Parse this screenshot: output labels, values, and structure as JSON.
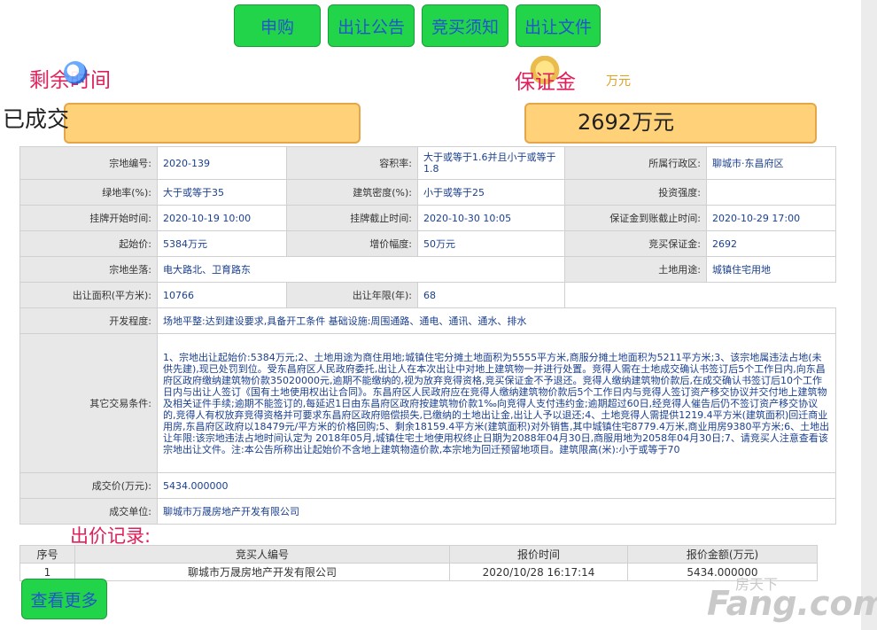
{
  "tabs": [
    "申购",
    "出让公告",
    "竞买须知",
    "出让文件"
  ],
  "header": {
    "remaining_label": "剩余时间",
    "deposit_label": "保证金",
    "deposit_unit": "万元",
    "status": "已成交",
    "deposit_value": "2692万元"
  },
  "info": {
    "code_label": "宗地编号:",
    "code": "2020-139",
    "far_label": "容积率:",
    "far": "大于或等于1.6并且小于或等于1.8",
    "district_label": "所属行政区:",
    "district": "聊城市·东昌府区",
    "green_label": "绿地率(%):",
    "green": "大于或等于35",
    "density_label": "建筑密度(%):",
    "density": "小于或等于25",
    "intensity_label": "投资强度:",
    "intensity": "",
    "start_label": "挂牌开始时间:",
    "start": "2020-10-19 10:00",
    "end_label": "挂牌截止时间:",
    "end": "2020-10-30 10:05",
    "deposit_deadline_label": "保证金到账截止时间:",
    "deposit_deadline": "2020-10-29 17:00",
    "start_price_label": "起始价:",
    "start_price": "5384万元",
    "increment_label": "增价幅度:",
    "increment": "50万元",
    "bid_deposit_label": "竞买保证金:",
    "bid_deposit": "2692",
    "location_label": "宗地坐落:",
    "location": "电大路北、卫育路东",
    "use_label": "土地用途:",
    "use": "城镇住宅用地",
    "area_label": "出让面积(平方米):",
    "area": "10766",
    "years_label": "出让年限(年):",
    "years": "68",
    "dev_label": "开发程度:",
    "dev": "场地平整:达到建设要求,具备开工条件 基础设施:周围通路、通电、通讯、通水、排水",
    "other_label": "其它交易条件:",
    "other": "1、宗地出让起始价:5384万元;2、土地用途为商住用地;城镇住宅分摊土地面积为5555平方米,商服分摊土地面积为5211平方米;3、该宗地属违法占地(未供先建),现已处罚到位。受东昌府区人民政府委托,出让人在本次出让中对地上建筑物一并进行处置。竞得人需在土地成交确认书签订后5个工作日内,向东昌府区政府缴纳建筑物价款35020000元,逾期不能缴纳的,视为放弃竞得资格,竞买保证金不予退还。竞得人缴纳建筑物价款后,在成交确认书签订后10个工作日内与出让人签订《国有土地使用权出让合同》。东昌府区人民政府应在竞得人缴纳建筑物价款后5个工作日内与竞得人签订资产移交协议并交付地上建筑物及相关证件手续;逾期不能签订的,每延迟1日由东昌府区政府按建筑物价款1‰向竞得人支付违约金;逾期超过60日,经竞得人催告后仍不签订资产移交协议的,竞得人有权放弃竞得资格并可要求东昌府区政府赔偿损失,已缴纳的土地出让金,出让人予以退还;4、土地竞得人需提供1219.4平方米(建筑面积)回迁商业用房,东昌府区政府以18479元/平方米的价格回购;5、剩余18159.4平方米(建筑面积)对外销售,其中城镇住宅8779.4万米,商业用房9380平方米;6、土地出让年限:该宗地违法占地时间认定为 2018年05月,城镇住宅土地使用权终止日期为2088年04月30日,商服用地为2058年04月30日;7、请竞买人注意查看该宗地出让文件。注:本公告所称出让起始价不含地上建筑物造价款,本宗地为回迁预留地项目。建筑限高(米):小于或等于70",
    "deal_price_label": "成交价(万元):",
    "deal_price": "5434.000000",
    "deal_unit_label": "成交单位:",
    "deal_unit": "聊城市万晟房地产开发有限公司"
  },
  "bids": {
    "title": "出价记录:",
    "columns": [
      "序号",
      "竞买人编号",
      "报价时间",
      "报价金额(万元)"
    ],
    "rows": [
      [
        "1",
        "聊城市万晟房地产开发有限公司",
        "2020/10/28 16:17:14",
        "5434.000000"
      ]
    ]
  },
  "more_button": "查看更多",
  "watermark": {
    "top": "房天下",
    "main": "Fang.com"
  }
}
